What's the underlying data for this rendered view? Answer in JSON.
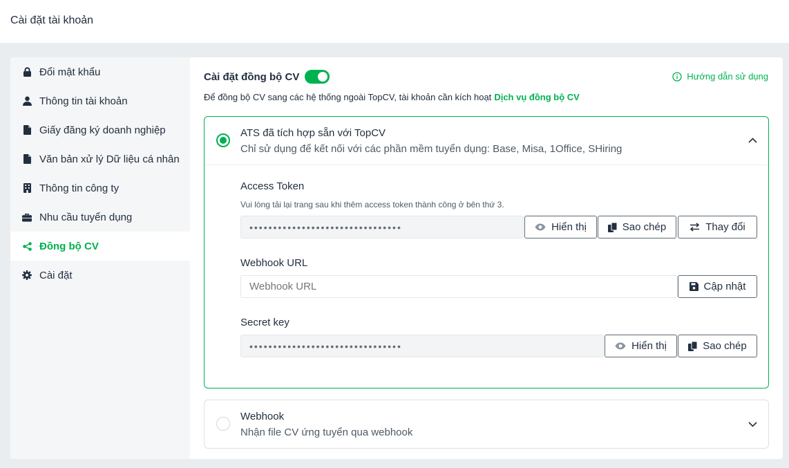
{
  "page": {
    "title": "Cài đặt tài khoản"
  },
  "sidebar": {
    "items": [
      {
        "label": "Đổi mật khẩu",
        "icon": "lock-icon"
      },
      {
        "label": "Thông tin tài khoản",
        "icon": "user-icon"
      },
      {
        "label": "Giấy đăng ký doanh nghiệp",
        "icon": "file-icon"
      },
      {
        "label": "Văn bản xử lý Dữ liệu cá nhân",
        "icon": "file-icon"
      },
      {
        "label": "Thông tin công ty",
        "icon": "building-icon"
      },
      {
        "label": "Nhu cầu tuyển dụng",
        "icon": "briefcase-icon"
      },
      {
        "label": "Đồng bộ CV",
        "icon": "share-icon",
        "active": true
      },
      {
        "label": "Cài đặt",
        "icon": "gear-icon"
      }
    ]
  },
  "sync": {
    "title": "Cài đặt đồng bộ CV",
    "enabled": true,
    "guide_label": "Hướng dẫn sử dụng",
    "description": "Để đồng bộ CV sang các hệ thống ngoài TopCV, tài khoản cần kích hoạt",
    "service_link": "Dịch vụ đồng bộ CV"
  },
  "ats": {
    "title": "ATS đã tích hợp sẵn với TopCV",
    "subtitle": "Chỉ sử dụng để kết nối với các phần mềm tuyển dụng: Base, Misa, 1Office, SHiring",
    "selected": true,
    "access_token": {
      "label": "Access Token",
      "hint": "Vui lòng tải lại trang sau khi thêm access token thành công ở bên thứ 3.",
      "value": "••••••••••••••••••••••••••••••••",
      "show_label": "Hiển thị",
      "copy_label": "Sao chép",
      "change_label": "Thay đổi"
    },
    "webhook_url": {
      "label": "Webhook URL",
      "placeholder": "Webhook URL",
      "update_label": "Cập nhật"
    },
    "secret_key": {
      "label": "Secret key",
      "value": "••••••••••••••••••••••••••••••••",
      "show_label": "Hiển thị",
      "copy_label": "Sao chép"
    }
  },
  "webhook": {
    "title": "Webhook",
    "subtitle": "Nhận file CV ứng tuyển qua webhook",
    "selected": false
  },
  "colors": {
    "accent": "#00b14f",
    "text": "#212f3f",
    "background": "#e9edf0"
  }
}
